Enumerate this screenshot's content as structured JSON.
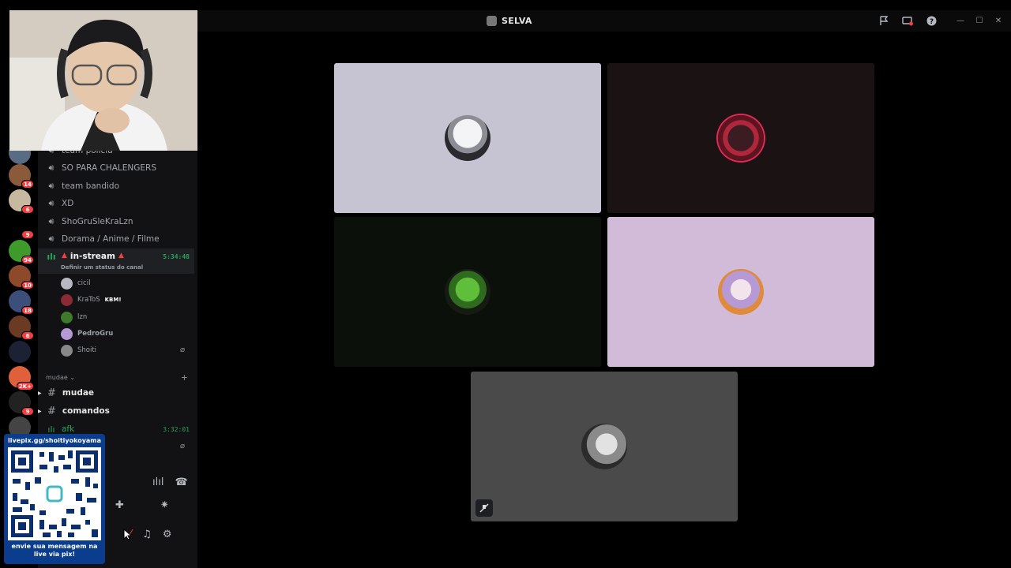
{
  "titlebar": {
    "server_name": "SELVA",
    "icons": [
      "flag-icon",
      "screen-share-icon",
      "help-icon"
    ],
    "window_controls": [
      "minimize-icon",
      "maximize-icon",
      "close-icon"
    ]
  },
  "tiles": [
    {
      "id": "tile-1",
      "bg": "#c6c3d3"
    },
    {
      "id": "tile-2",
      "bg": "#1a1213"
    },
    {
      "id": "tile-3",
      "bg": "#0c100b"
    },
    {
      "id": "tile-4",
      "bg": "#d2bbd8"
    },
    {
      "id": "tile-5",
      "bg": "#4a4a4a"
    }
  ],
  "server_badges": [
    "14",
    "6",
    "9",
    "94",
    "10",
    "18",
    "6",
    "2K+",
    "9"
  ],
  "voice_channels": [
    "team polícia",
    "SO PARA CHALENGERS",
    "team bandido",
    "XD",
    "ShoGruSleKraLzn",
    "Dorama / Anime / Filme"
  ],
  "active_channel": {
    "name": "in-stream",
    "duration": "5:34:48",
    "status": "Definir um status do canal"
  },
  "members": [
    {
      "name": "cicil",
      "tag": ""
    },
    {
      "name": "KraToS",
      "tag": "KBM!"
    },
    {
      "name": "lzn",
      "tag": ""
    },
    {
      "name": "PedroGru",
      "tag": ""
    },
    {
      "name": "Shoiti",
      "tag": ""
    }
  ],
  "category": "mudae",
  "text_channels": [
    "mudae",
    "comandos"
  ],
  "afk_channel": {
    "name": "afk",
    "duration": "3:32:01"
  },
  "overlay": {
    "pix_url": "livepix.gg/shoitiyokoyama",
    "pix_message": "envie sua mensagem na live via pix!"
  }
}
